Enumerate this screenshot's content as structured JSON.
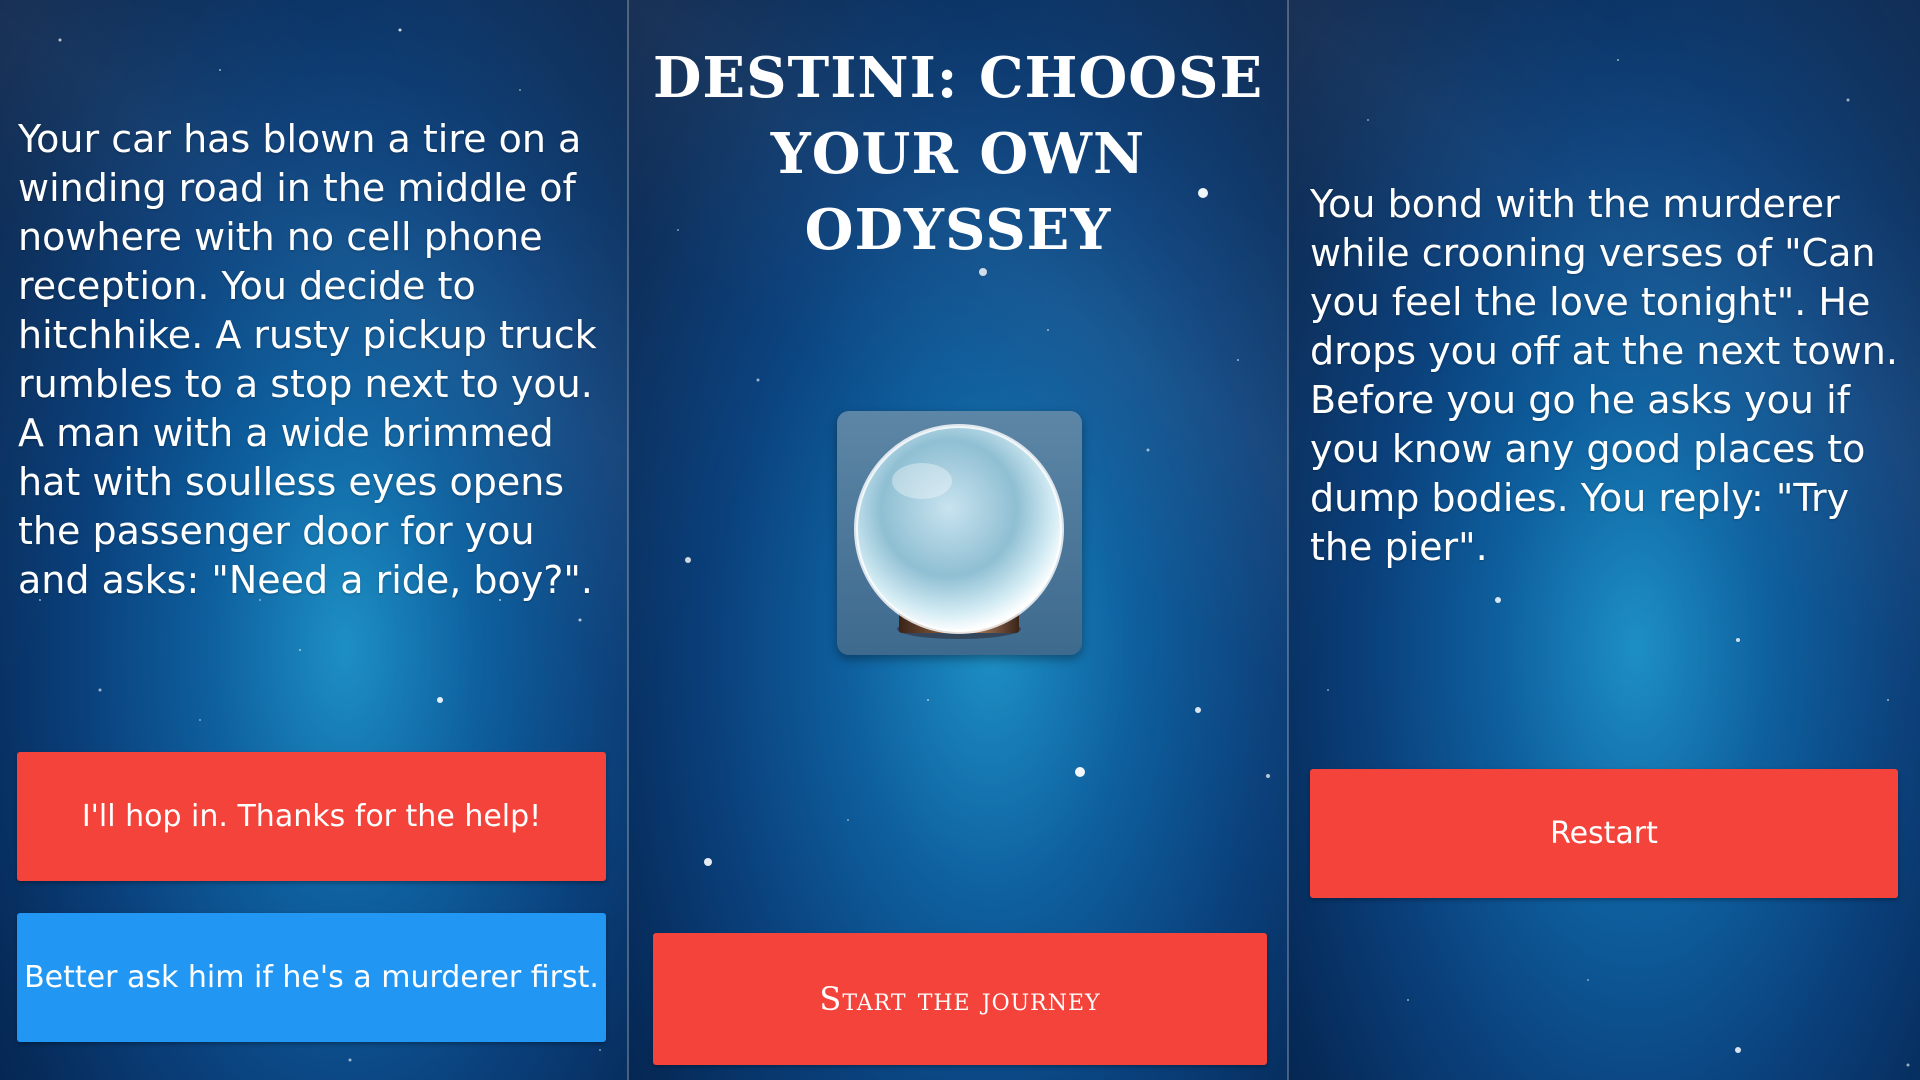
{
  "left_screen": {
    "story": "Your car has blown a tire on a winding road in the middle of nowhere with no cell phone reception. You decide to hitchhike. A rusty pickup truck rumbles to a stop next to you. A man with a wide brimmed hat with soulless eyes opens the passenger door for you and asks: \"Need a ride, boy?\".",
    "choice1_label": "I'll hop in. Thanks for the help!",
    "choice2_label": "Better ask him if he's a murderer first.",
    "choice1_color": "#f4433a",
    "choice2_color": "#2196f3"
  },
  "middle_screen": {
    "title": "Destini: Choose Your Own Odyssey",
    "icon": "crystal-ball-icon",
    "start_label": "Start the journey"
  },
  "right_screen": {
    "story": "You bond with the murderer while crooning verses of \"Can you feel the love tonight\". He drops you off at the next town. Before you go he asks you if you know any good places to dump bodies. You reply: \"Try the pier\".",
    "restart_label": "Restart"
  },
  "colors": {
    "background": "#0a3f7a",
    "button_red": "#f4433a",
    "button_blue": "#2196f3"
  }
}
